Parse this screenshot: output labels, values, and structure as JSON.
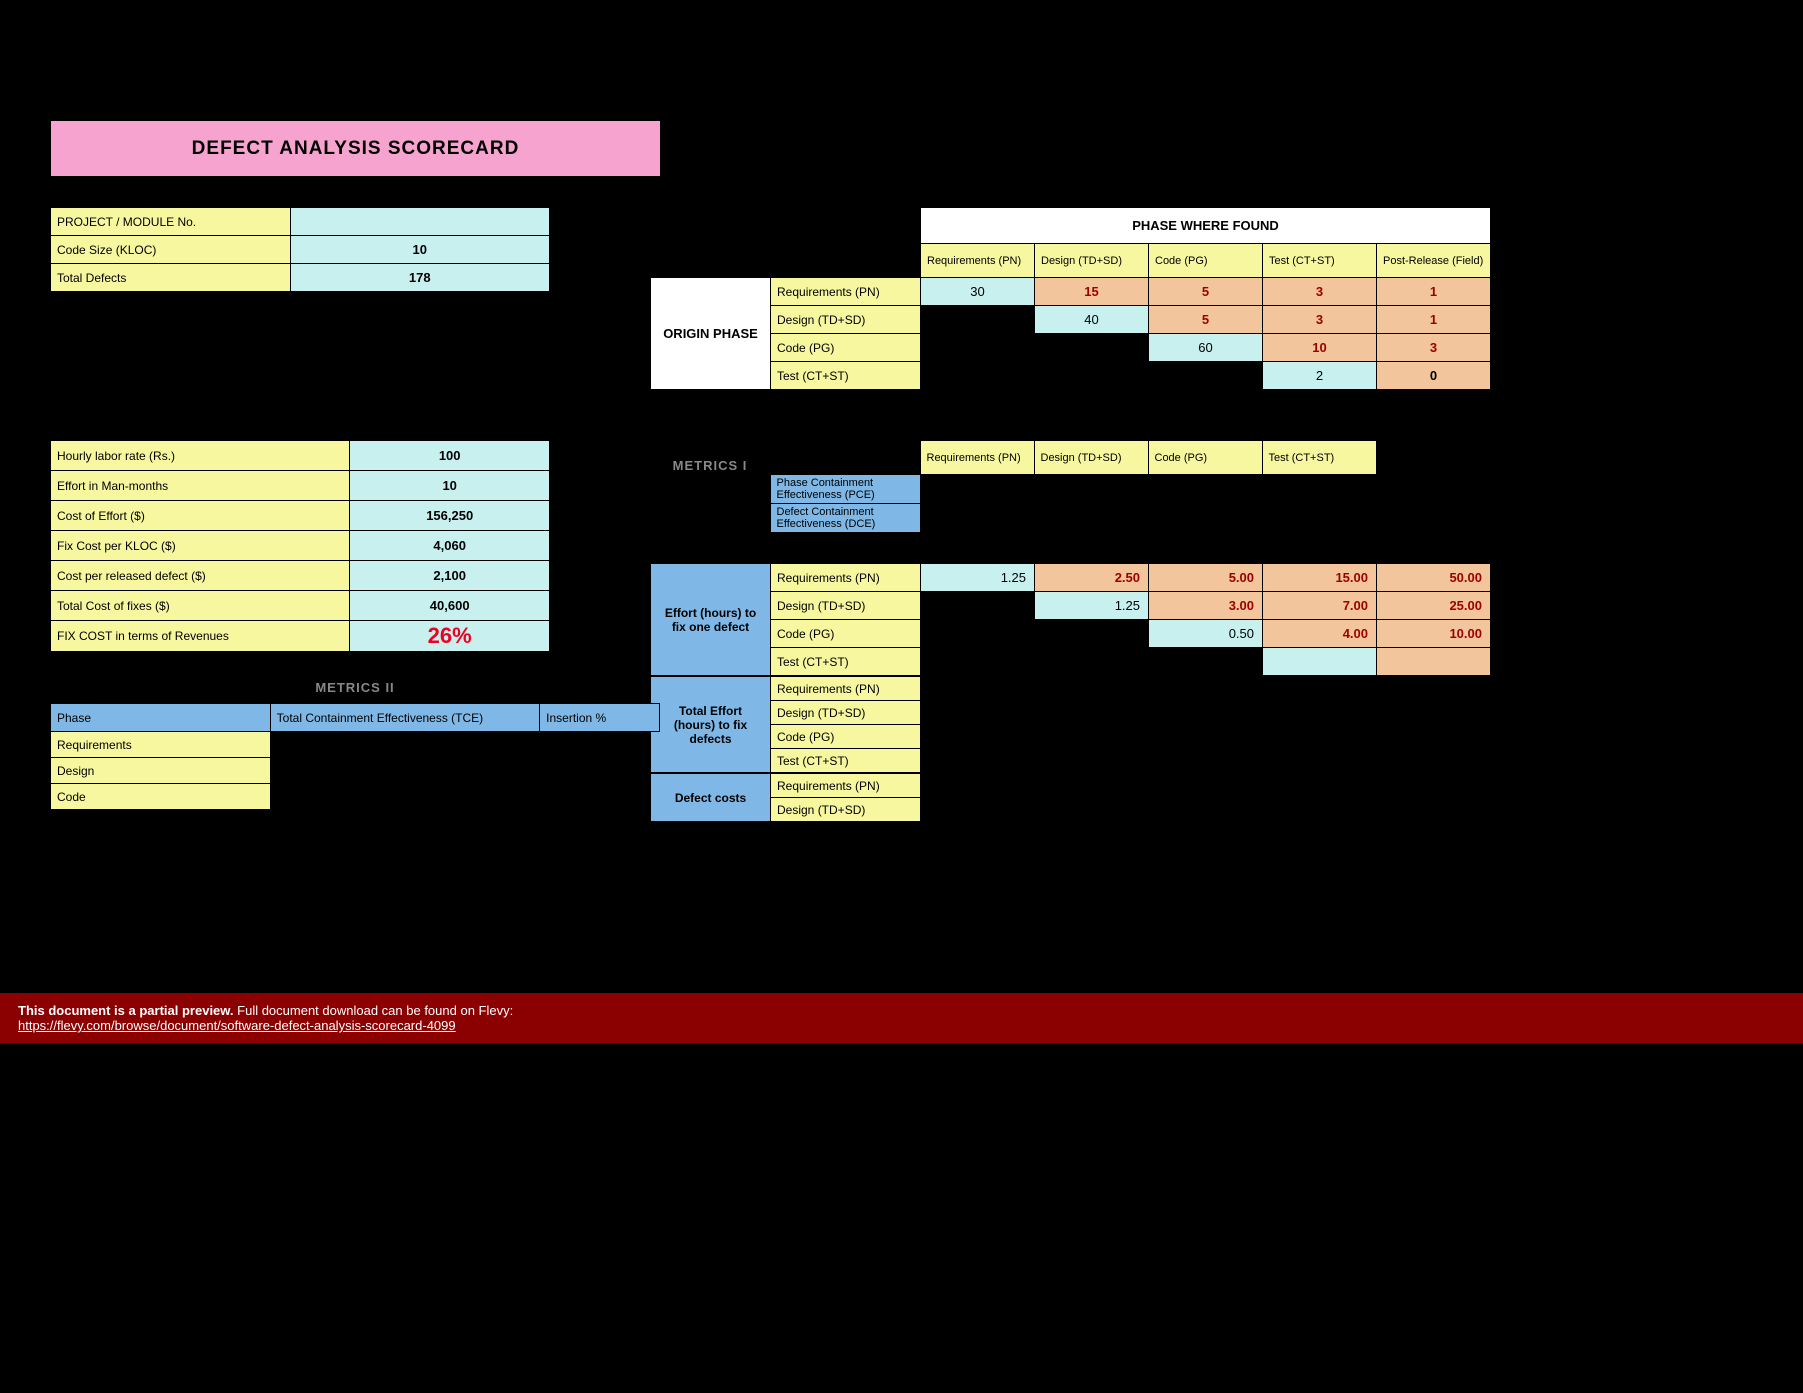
{
  "title": "DEFECT ANALYSIS SCORECARD",
  "left1": {
    "rows": [
      {
        "label": "PROJECT / MODULE No.",
        "value": ""
      },
      {
        "label": "Code Size (KLOC)",
        "value": "10"
      },
      {
        "label": "Total Defects",
        "value": "178"
      }
    ]
  },
  "left2": {
    "rows": [
      {
        "label": "Hourly labor rate (Rs.)",
        "value": "100"
      },
      {
        "label": "Effort in Man-months",
        "value": "10"
      },
      {
        "label": "Cost of Effort ($)",
        "value": "156,250"
      },
      {
        "label": "Fix Cost per KLOC ($)",
        "value": "4,060"
      },
      {
        "label": "Cost per released defect ($)",
        "value": "2,100"
      },
      {
        "label": "Total Cost of fixes ($)",
        "value": "40,600"
      },
      {
        "label": "FIX COST in terms of Revenues",
        "value": "26%"
      }
    ]
  },
  "phase_header": "PHASE WHERE FOUND",
  "phase_cols": [
    "Requirements (PN)",
    "Design (TD+SD)",
    "Code (PG)",
    "Test (CT+ST)",
    "Post-Release (Field)"
  ],
  "origin_label": "ORIGIN PHASE",
  "origin_rows": [
    "Requirements (PN)",
    "Design (TD+SD)",
    "Code (PG)",
    "Test (CT+ST)"
  ],
  "origin_matrix": [
    [
      {
        "v": "30",
        "c": "cyanval"
      },
      {
        "v": "15",
        "c": "orangeval"
      },
      {
        "v": "5",
        "c": "orangeval"
      },
      {
        "v": "3",
        "c": "orangeval"
      },
      {
        "v": "1",
        "c": "orangeval"
      }
    ],
    [
      {
        "v": "",
        "c": "noborder"
      },
      {
        "v": "40",
        "c": "cyanval"
      },
      {
        "v": "5",
        "c": "orangeval"
      },
      {
        "v": "3",
        "c": "orangeval"
      },
      {
        "v": "1",
        "c": "orangeval"
      }
    ],
    [
      {
        "v": "",
        "c": "noborder"
      },
      {
        "v": "",
        "c": "noborder"
      },
      {
        "v": "60",
        "c": "cyanval"
      },
      {
        "v": "10",
        "c": "orangeval"
      },
      {
        "v": "3",
        "c": "orangeval"
      }
    ],
    [
      {
        "v": "",
        "c": "noborder"
      },
      {
        "v": "",
        "c": "noborder"
      },
      {
        "v": "",
        "c": "noborder"
      },
      {
        "v": "2",
        "c": "cyanval"
      },
      {
        "v": "0",
        "c": "orangeval2"
      }
    ]
  ],
  "metrics1_label": "METRICS I",
  "metrics1_cols": [
    "Requirements (PN)",
    "Design (TD+SD)",
    "Code (PG)",
    "Test (CT+ST)"
  ],
  "metrics1_rows": [
    "Phase Containment Effectiveness (PCE)",
    "Defect Containment Effectiveness (DCE)"
  ],
  "effort_label": "Effort (hours) to fix one defect",
  "effort_rows": [
    "Requirements (PN)",
    "Design (TD+SD)",
    "Code (PG)",
    "Test (CT+ST)"
  ],
  "effort_matrix": [
    [
      {
        "v": "1.25",
        "c": "cyanval right"
      },
      {
        "v": "2.50",
        "c": "orangeval right"
      },
      {
        "v": "5.00",
        "c": "orangeval right"
      },
      {
        "v": "15.00",
        "c": "orangeval right"
      },
      {
        "v": "50.00",
        "c": "orangeval right"
      }
    ],
    [
      {
        "v": "",
        "c": "noborder"
      },
      {
        "v": "1.25",
        "c": "cyanval right"
      },
      {
        "v": "3.00",
        "c": "orangeval right"
      },
      {
        "v": "7.00",
        "c": "orangeval right"
      },
      {
        "v": "25.00",
        "c": "orangeval right"
      }
    ],
    [
      {
        "v": "",
        "c": "noborder"
      },
      {
        "v": "",
        "c": "noborder"
      },
      {
        "v": "0.50",
        "c": "cyanval right"
      },
      {
        "v": "4.00",
        "c": "orangeval right"
      },
      {
        "v": "10.00",
        "c": "orangeval right"
      }
    ],
    [
      {
        "v": "",
        "c": "noborder"
      },
      {
        "v": "",
        "c": "noborder"
      },
      {
        "v": "",
        "c": "noborder"
      },
      {
        "v": "",
        "c": "cyanval"
      },
      {
        "v": "",
        "c": "orangeval"
      }
    ]
  ],
  "total_effort_label": "Total Effort (hours) to fix defects",
  "total_effort_rows": [
    "Requirements (PN)",
    "Design (TD+SD)",
    "Code (PG)",
    "Test (CT+ST)"
  ],
  "defect_costs_label": "Defect costs",
  "defect_costs_rows": [
    "Requirements (PN)",
    "Design (TD+SD)"
  ],
  "metrics2_label": "METRICS II",
  "metrics2_header": [
    "Phase",
    "Total Containment Effectiveness (TCE)",
    "Insertion %"
  ],
  "metrics2_rows": [
    "Requirements",
    "Design",
    "Code"
  ],
  "footer_bold": "This document is a partial preview.",
  "footer_text": " Full document download can be found on Flevy:",
  "footer_link": "https://flevy.com/browse/document/software-defect-analysis-scorecard-4099"
}
